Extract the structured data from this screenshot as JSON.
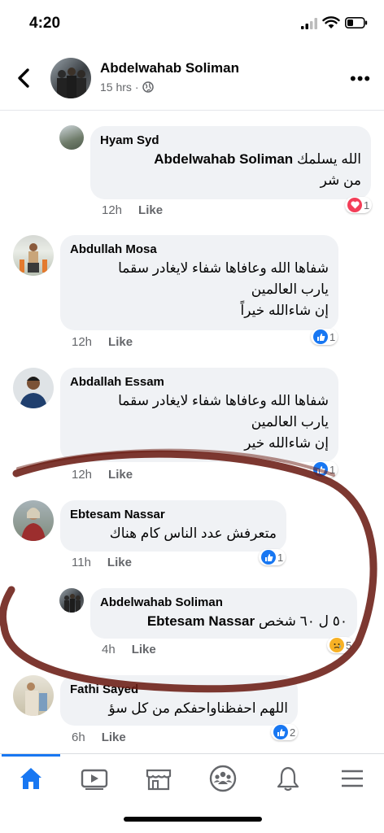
{
  "status_bar": {
    "time": "4:20"
  },
  "header": {
    "name": "Abdelwahab Soliman",
    "time": "15 hrs",
    "separator": "·"
  },
  "comments": [
    {
      "author": "Hyam Syd",
      "text_mention": "Abdelwahab Soliman",
      "text_line1": "الله يسلمك",
      "text_line2": "من شر",
      "time": "12h",
      "like_label": "Like",
      "reaction": "love-icon",
      "reaction_count": "1"
    },
    {
      "author": "Abdullah Mosa",
      "text_line1": "شفاها الله وعافاها شفاء لايغادر سقما",
      "text_line2": "يارب العالمين",
      "text_line3": "إن شاءالله خيراً",
      "time": "12h",
      "like_label": "Like",
      "reaction": "like-icon",
      "reaction_count": "1"
    },
    {
      "author": "Abdallah Essam",
      "text_line1": "شفاها الله وعافاها شفاء لايغادر سقما",
      "text_line2": "يارب العالمين",
      "text_line3": "إن شاءالله خير",
      "time": "12h",
      "like_label": "Like",
      "reaction": "like-icon",
      "reaction_count": "1"
    },
    {
      "author": "Ebtesam Nassar",
      "text_line1": "متعرفش عدد الناس كام هناك",
      "time": "11h",
      "like_label": "Like",
      "reaction": "like-icon",
      "reaction_count": "1"
    },
    {
      "author": "Abdelwahab Soliman",
      "text_mention": "Ebtesam Nassar",
      "text_line1": "٥٠ ل ٦٠ شخص",
      "time": "4h",
      "like_label": "Like",
      "reaction": "sad-icon",
      "reaction_count": "5"
    },
    {
      "author": "Fathi Sayed",
      "text_line1": "اللهم احفظناواحفكم من كل سؤ",
      "time": "6h",
      "like_label": "Like",
      "reaction": "like-icon",
      "reaction_count": "2"
    }
  ],
  "tabs": [
    "home-tab",
    "watch-tab",
    "marketplace-tab",
    "groups-tab",
    "notifications-tab",
    "menu-tab"
  ],
  "colors": {
    "accent": "#1877f2",
    "bubble": "#f0f2f5",
    "muted": "#65676b",
    "scribble": "#6b1d14"
  }
}
